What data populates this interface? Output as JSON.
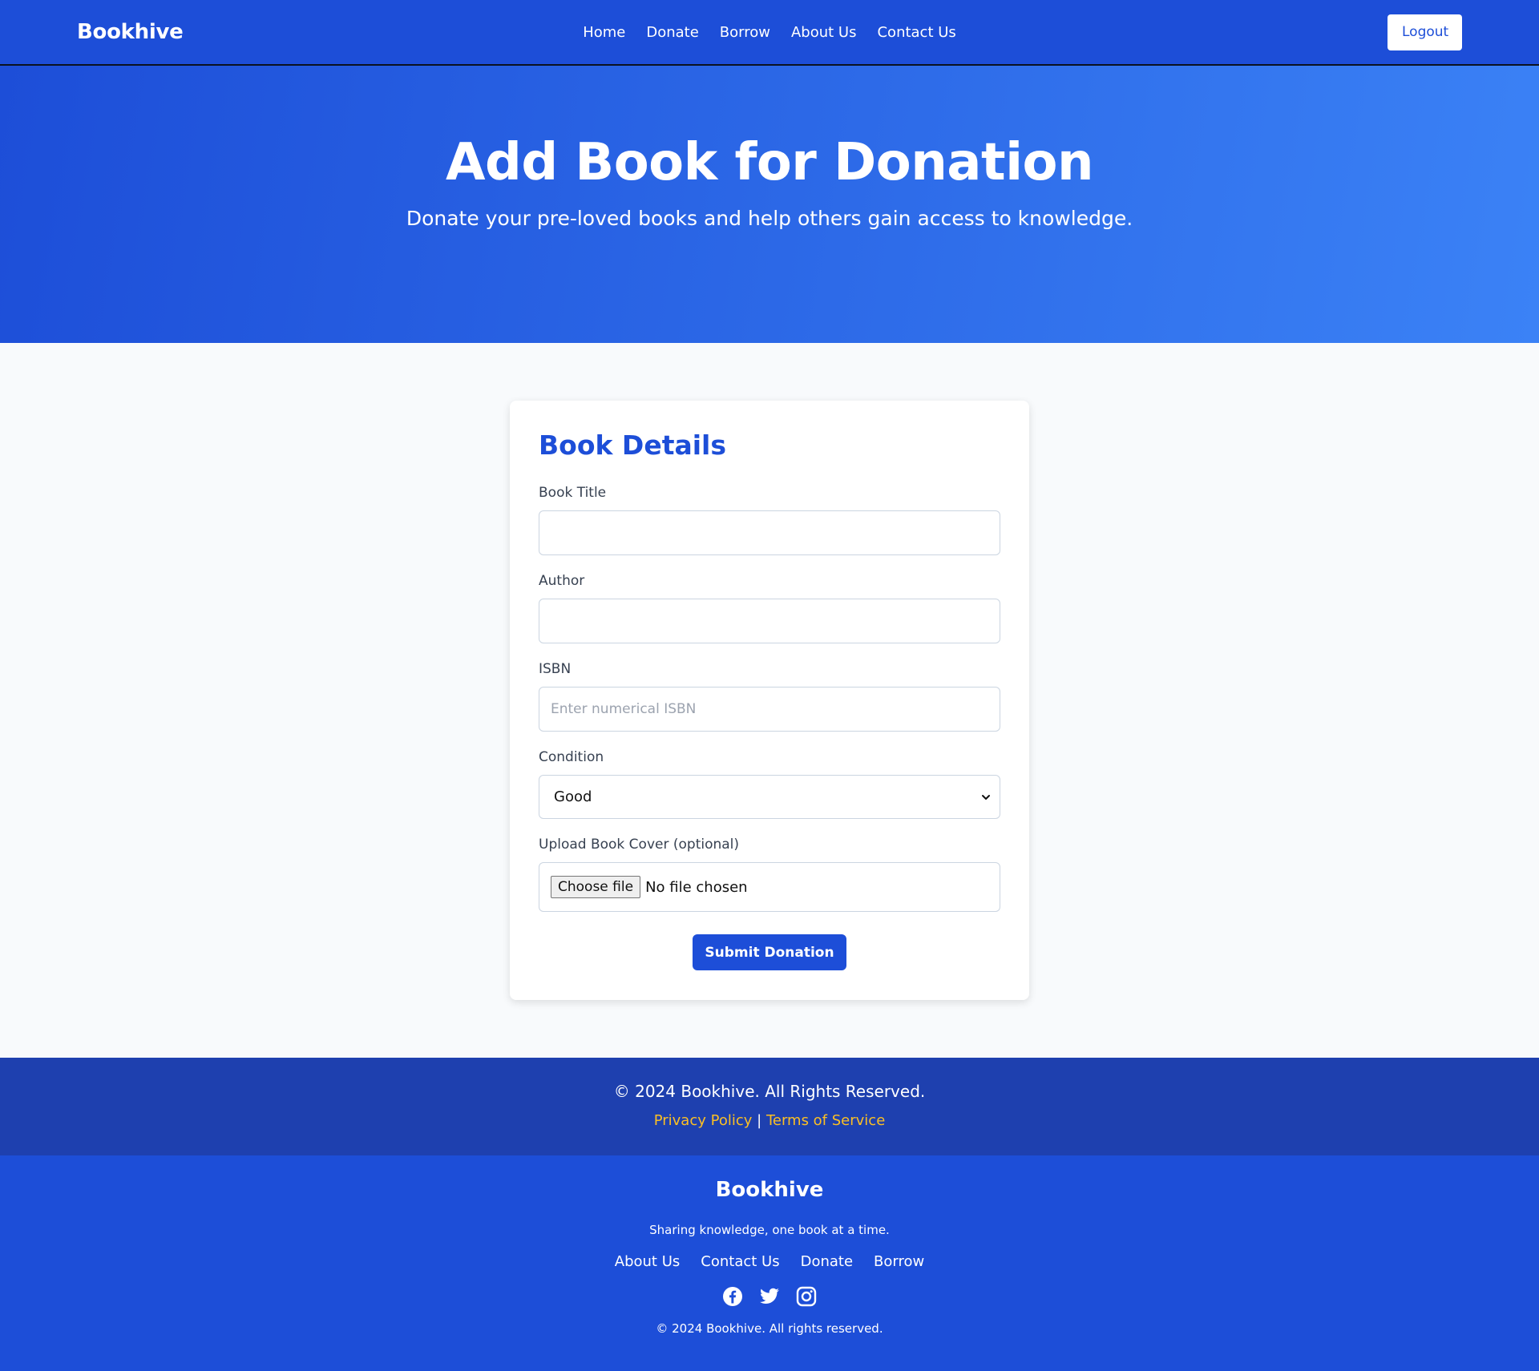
{
  "nav": {
    "brand": "Bookhive",
    "links": [
      "Home",
      "Donate",
      "Borrow",
      "About Us",
      "Contact Us"
    ],
    "logout_label": "Logout"
  },
  "hero": {
    "title": "Add Book for Donation",
    "subtitle": "Donate your pre-loved books and help others gain access to knowledge."
  },
  "form": {
    "heading": "Book Details",
    "title_label": "Book Title",
    "title_value": "",
    "author_label": "Author",
    "author_value": "",
    "isbn_label": "ISBN",
    "isbn_placeholder": "Enter numerical ISBN",
    "condition_label": "Condition",
    "condition_value": "Good",
    "cover_label": "Upload Book Cover (optional)",
    "file_button_label": "Choose file",
    "file_status": "No file chosen",
    "submit_label": "Submit Donation"
  },
  "footer_top": {
    "copyright": "© 2024 Bookhive. All Rights Reserved.",
    "privacy_label": "Privacy Policy",
    "separator": "|",
    "terms_label": "Terms of Service"
  },
  "footer_bottom": {
    "brand": "Bookhive",
    "tagline": "Sharing knowledge, one book at a time.",
    "links": [
      "About Us",
      "Contact Us",
      "Donate",
      "Borrow"
    ],
    "socials": [
      "facebook-icon",
      "twitter-icon",
      "instagram-icon"
    ],
    "rights": "© 2024 Bookhive. All rights reserved."
  },
  "colors": {
    "primary": "#1d4ed8",
    "primary_dark": "#1e40af",
    "accent_link": "#fbbf24",
    "hero_gradient_end": "#3b82f6"
  }
}
